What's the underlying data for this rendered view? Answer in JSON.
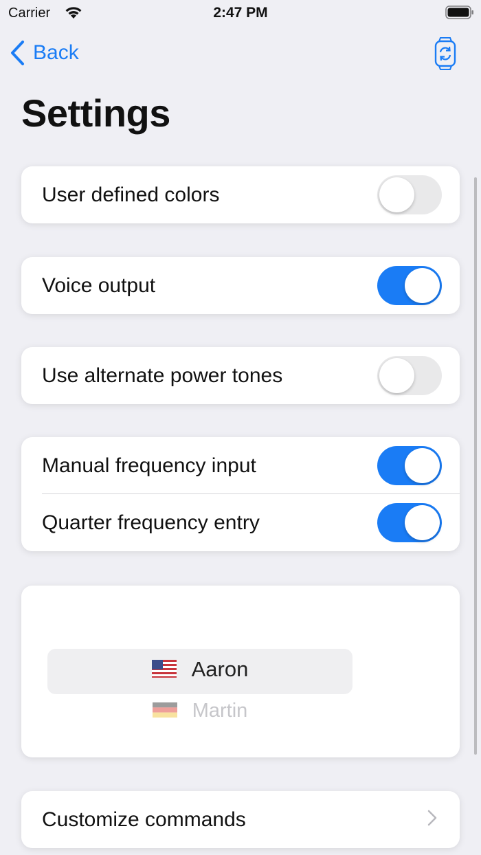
{
  "status_bar": {
    "carrier": "Carrier",
    "time": "2:47 PM"
  },
  "nav": {
    "back_label": "Back",
    "right_icon": "watch-sync-icon"
  },
  "title": "Settings",
  "settings": {
    "user_defined_colors": {
      "label": "User defined colors",
      "on": false
    },
    "voice_output": {
      "label": "Voice output",
      "on": true
    },
    "alternate_power_tones": {
      "label": "Use alternate power tones",
      "on": false
    },
    "manual_frequency_input": {
      "label": "Manual frequency input",
      "on": true
    },
    "quarter_frequency_entry": {
      "label": "Quarter frequency entry",
      "on": true
    }
  },
  "voice_picker": {
    "options": [
      {
        "name": "Aaron",
        "flag": "us-flag-icon",
        "selected": true
      },
      {
        "name": "Martin",
        "flag": "de-flag-icon",
        "selected": false
      }
    ]
  },
  "customize_commands": {
    "label": "Customize commands"
  },
  "colors": {
    "accent": "#1a7cf5",
    "background": "#efeff4",
    "toggle_off": "#e9e9ea"
  }
}
